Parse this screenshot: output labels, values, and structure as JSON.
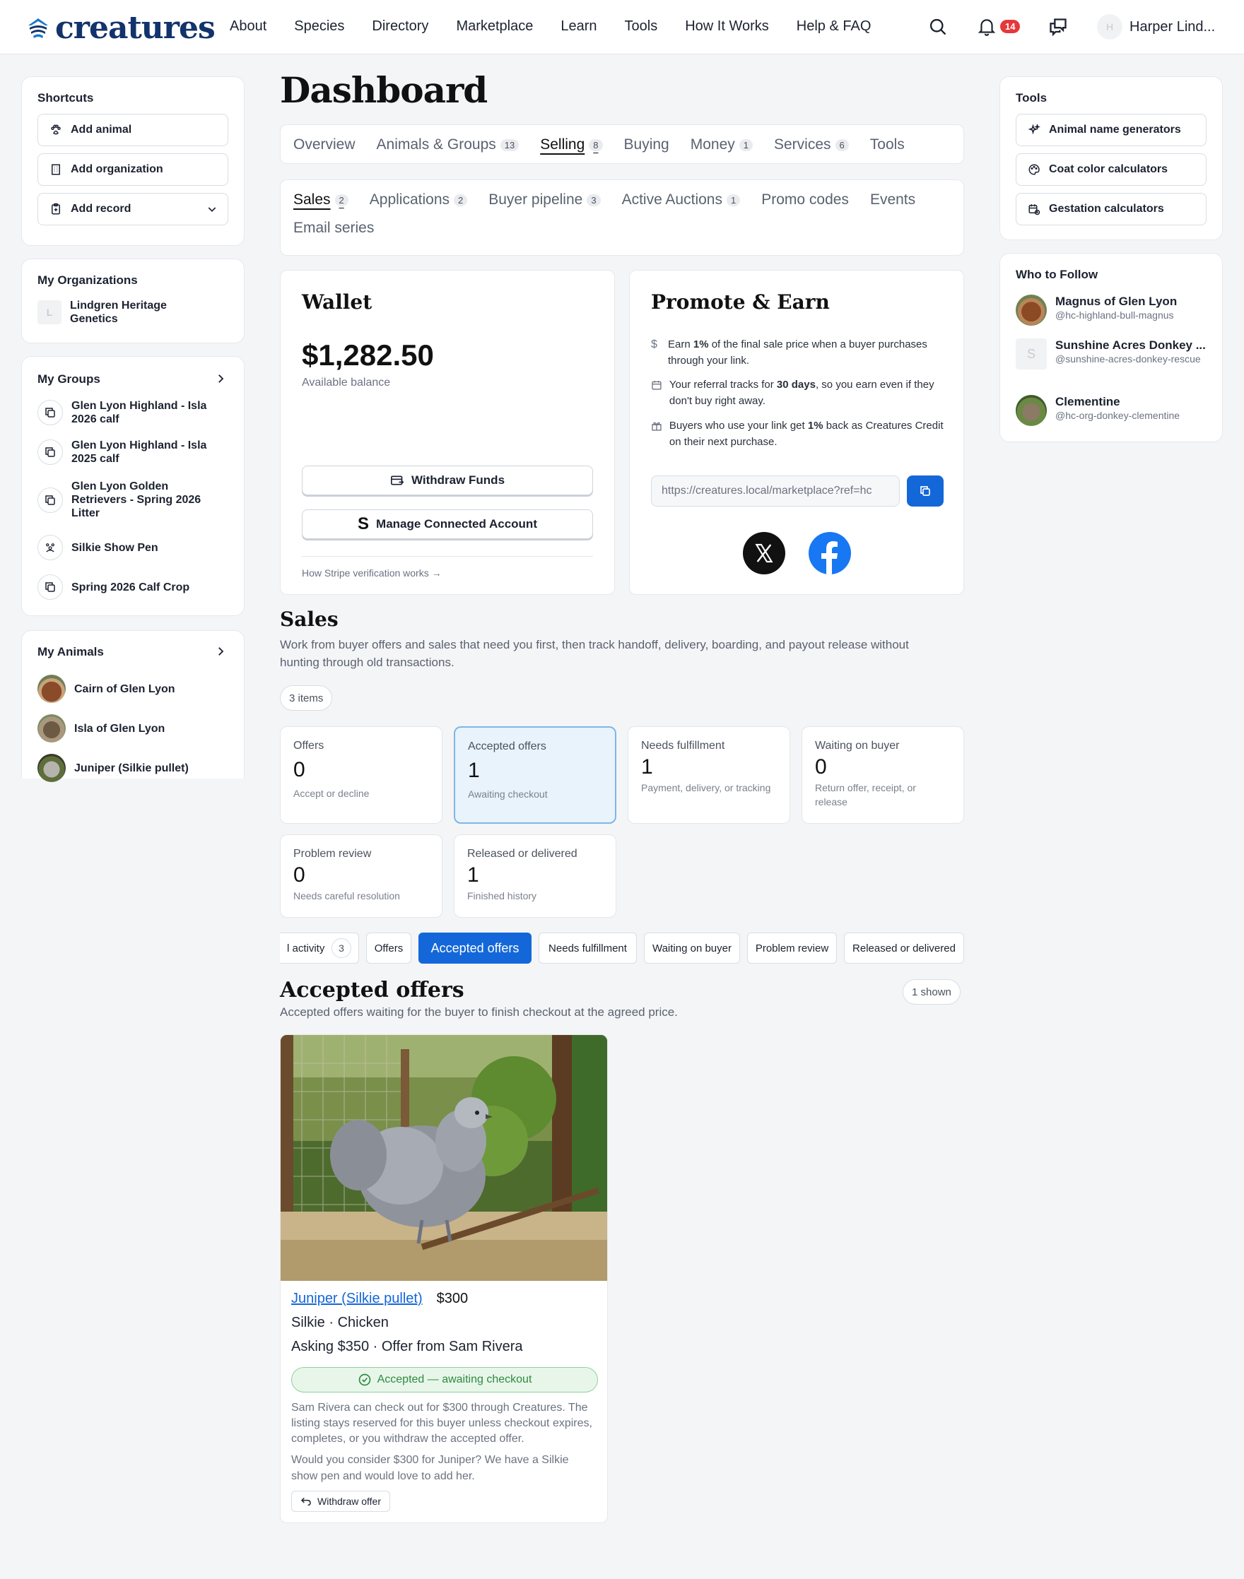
{
  "header": {
    "logo": "creatures",
    "nav": [
      "About",
      "Species",
      "Directory",
      "Marketplace",
      "Learn",
      "Tools",
      "How It Works",
      "Help & FAQ"
    ],
    "notifications_count": "14",
    "avatar_initial": "H",
    "user_name": "Harper Lind..."
  },
  "left": {
    "shortcuts": {
      "title": "Shortcuts",
      "items": [
        "Add animal",
        "Add organization",
        "Add record"
      ]
    },
    "organizations": {
      "title": "My Organizations",
      "items": [
        {
          "initial": "L",
          "name": "Lindgren Heritage Genetics"
        }
      ]
    },
    "groups": {
      "title": "My Groups",
      "items": [
        "Glen Lyon Highland - Isla 2026 calf",
        "Glen Lyon Highland - Isla 2025 calf",
        "Glen Lyon Golden Retrievers - Spring 2026 Litter",
        "Silkie Show Pen",
        "Spring 2026 Calf Crop"
      ]
    },
    "animals": {
      "title": "My Animals",
      "items": [
        "Cairn of Glen Lyon",
        "Isla of Glen Lyon",
        "Juniper (Silkie pullet)"
      ]
    }
  },
  "main": {
    "title": "Dashboard",
    "tabs": [
      {
        "label": "Overview",
        "count": ""
      },
      {
        "label": "Animals & Groups",
        "count": "13"
      },
      {
        "label": "Selling",
        "count": "8"
      },
      {
        "label": "Buying",
        "count": ""
      },
      {
        "label": "Money",
        "count": "1"
      },
      {
        "label": "Services",
        "count": "6"
      },
      {
        "label": "Tools",
        "count": ""
      }
    ],
    "subtabs": [
      {
        "label": "Sales",
        "count": "2"
      },
      {
        "label": "Applications",
        "count": "2"
      },
      {
        "label": "Buyer pipeline",
        "count": "3"
      },
      {
        "label": "Active Auctions",
        "count": "1"
      },
      {
        "label": "Promo codes",
        "count": ""
      },
      {
        "label": "Events",
        "count": ""
      },
      {
        "label": "Email series",
        "count": ""
      }
    ],
    "wallet": {
      "title": "Wallet",
      "balance": "$1,282.50",
      "balance_label": "Available balance",
      "withdraw_label": "Withdraw Funds",
      "manage_label": "Manage Connected Account",
      "stripe_link": "How Stripe verification works →"
    },
    "promote": {
      "title": "Promote & Earn",
      "rows": [
        {
          "pre": "Earn ",
          "bold": "1%",
          "post": " of the final sale price when a buyer purchases through your link."
        },
        {
          "pre": "Your referral tracks for ",
          "bold": "30 days",
          "post": ", so you earn even if they don't buy right away."
        },
        {
          "pre": "Buyers who use your link get ",
          "bold": "1%",
          "post": " back as Creatures Credit on their next purchase."
        }
      ],
      "link_value": "https://creatures.local/marketplace?ref=hc"
    },
    "sales": {
      "title": "Sales",
      "description": "Work from buyer offers and sales that need you first, then track handoff, delivery, boarding, and payout release without hunting through old transactions.",
      "items_count": "3 items",
      "stats": [
        {
          "label": "Offers",
          "value": "0",
          "sub": "Accept or decline"
        },
        {
          "label": "Accepted offers",
          "value": "1",
          "sub": "Awaiting checkout"
        },
        {
          "label": "Needs fulfillment",
          "value": "1",
          "sub": "Payment, delivery, or tracking"
        },
        {
          "label": "Waiting on buyer",
          "value": "0",
          "sub": "Return offer, receipt, or release"
        },
        {
          "label": "Problem review",
          "value": "0",
          "sub": "Needs careful resolution"
        },
        {
          "label": "Released or delivered",
          "value": "1",
          "sub": "Finished history"
        }
      ],
      "filters": {
        "all_label": "l activity",
        "all_count": "3",
        "items": [
          "Offers",
          "Accepted offers",
          "Needs fulfillment",
          "Waiting on buyer",
          "Problem review",
          "Released or delivered"
        ]
      }
    },
    "accepted": {
      "title": "Accepted offers",
      "subtitle": "Accepted offers waiting for the buyer to finish checkout at the agreed price.",
      "shown": "1 shown",
      "listing": {
        "name": "Juniper (Silkie pullet)",
        "price": "$300",
        "breed": "Silkie · Chicken",
        "asking": "Asking $350 · Offer from Sam Rivera",
        "status": "Accepted — awaiting checkout",
        "note": "Sam Rivera can check out for $300 through Creatures. The listing stays reserved for this buyer unless checkout expires, completes, or you withdraw the accepted offer.",
        "message": "Would you consider $300 for Juniper? We have a Silkie show pen and would love to add her.",
        "withdraw_label": "Withdraw offer"
      }
    }
  },
  "right": {
    "tools": {
      "title": "Tools",
      "items": [
        "Animal name generators",
        "Coat color calculators",
        "Gestation calculators"
      ]
    },
    "follow": {
      "title": "Who to Follow",
      "items": [
        {
          "name": "Magnus of Glen Lyon",
          "handle": "@hc-highland-bull-magnus"
        },
        {
          "name": "Sunshine Acres Donkey ...",
          "handle": "@sunshine-acres-donkey-rescue",
          "initial": "S"
        },
        {
          "name": "Clementine",
          "handle": "@hc-org-donkey-clementine"
        }
      ]
    }
  },
  "colors": {
    "brand": "#12336b",
    "accent": "#1467d8",
    "success": "#2e8a3e",
    "badge": "#e5383b"
  }
}
